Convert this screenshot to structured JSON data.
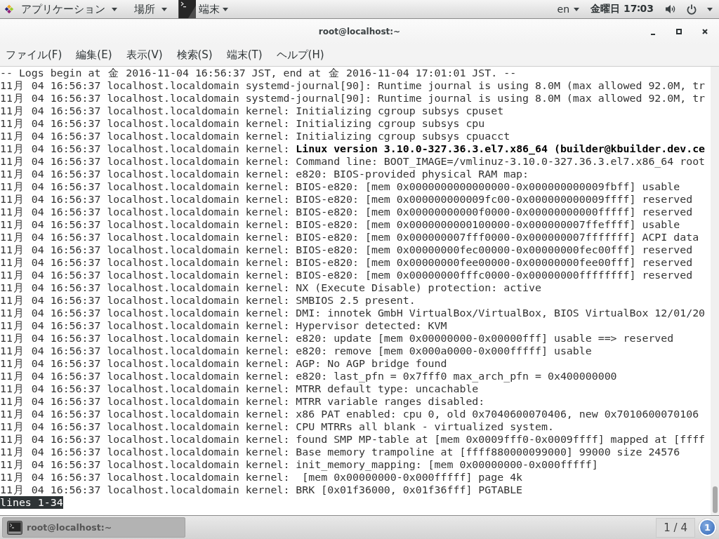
{
  "top_panel": {
    "applications": "アプリケーション",
    "places": "場所",
    "active_app": "端末",
    "input_source": "en",
    "clock": "金曜日 17∶03"
  },
  "window": {
    "title": "root@localhost:~"
  },
  "menu_bar": [
    "ファイル(F)",
    "編集(E)",
    "表示(V)",
    "検索(S)",
    "端末(T)",
    "ヘルプ(H)"
  ],
  "terminal": {
    "header": "-- Logs begin at 金 2016-11-04 16:56:37 JST, end at 金 2016-11-04 17:01:01 JST. --",
    "lines": [
      "11月 04 16:56:37 localhost.localdomain systemd-journal[90]: Runtime journal is using 8.0M (max allowed 92.0M, tr",
      "11月 04 16:56:37 localhost.localdomain systemd-journal[90]: Runtime journal is using 8.0M (max allowed 92.0M, tr",
      "11月 04 16:56:37 localhost.localdomain kernel: Initializing cgroup subsys cpuset",
      "11月 04 16:56:37 localhost.localdomain kernel: Initializing cgroup subsys cpu",
      "11月 04 16:56:37 localhost.localdomain kernel: Initializing cgroup subsys cpuacct",
      "11月 04 16:56:37 localhost.localdomain kernel: **Linux version 3.10.0-327.36.3.el7.x86_64 (builder@kbuilder.dev.ce**",
      "11月 04 16:56:37 localhost.localdomain kernel: Command line: BOOT_IMAGE=/vmlinuz-3.10.0-327.36.3.el7.x86_64 root",
      "11月 04 16:56:37 localhost.localdomain kernel: e820: BIOS-provided physical RAM map:",
      "11月 04 16:56:37 localhost.localdomain kernel: BIOS-e820: [mem 0x0000000000000000-0x000000000009fbff] usable",
      "11月 04 16:56:37 localhost.localdomain kernel: BIOS-e820: [mem 0x000000000009fc00-0x000000000009ffff] reserved",
      "11月 04 16:56:37 localhost.localdomain kernel: BIOS-e820: [mem 0x00000000000f0000-0x00000000000fffff] reserved",
      "11月 04 16:56:37 localhost.localdomain kernel: BIOS-e820: [mem 0x0000000000100000-0x000000007ffeffff] usable",
      "11月 04 16:56:37 localhost.localdomain kernel: BIOS-e820: [mem 0x000000007fff0000-0x000000007fffffff] ACPI data",
      "11月 04 16:56:37 localhost.localdomain kernel: BIOS-e820: [mem 0x00000000fec00000-0x00000000fec00fff] reserved",
      "11月 04 16:56:37 localhost.localdomain kernel: BIOS-e820: [mem 0x00000000fee00000-0x00000000fee00fff] reserved",
      "11月 04 16:56:37 localhost.localdomain kernel: BIOS-e820: [mem 0x00000000fffc0000-0x00000000ffffffff] reserved",
      "11月 04 16:56:37 localhost.localdomain kernel: NX (Execute Disable) protection: active",
      "11月 04 16:56:37 localhost.localdomain kernel: SMBIOS 2.5 present.",
      "11月 04 16:56:37 localhost.localdomain kernel: DMI: innotek GmbH VirtualBox/VirtualBox, BIOS VirtualBox 12/01/20",
      "11月 04 16:56:37 localhost.localdomain kernel: Hypervisor detected: KVM",
      "11月 04 16:56:37 localhost.localdomain kernel: e820: update [mem 0x00000000-0x00000fff] usable ==> reserved",
      "11月 04 16:56:37 localhost.localdomain kernel: e820: remove [mem 0x000a0000-0x000fffff] usable",
      "11月 04 16:56:37 localhost.localdomain kernel: AGP: No AGP bridge found",
      "11月 04 16:56:37 localhost.localdomain kernel: e820: last_pfn = 0x7fff0 max_arch_pfn = 0x400000000",
      "11月 04 16:56:37 localhost.localdomain kernel: MTRR default type: uncachable",
      "11月 04 16:56:37 localhost.localdomain kernel: MTRR variable ranges disabled:",
      "11月 04 16:56:37 localhost.localdomain kernel: x86 PAT enabled: cpu 0, old 0x7040600070406, new 0x7010600070106",
      "11月 04 16:56:37 localhost.localdomain kernel: CPU MTRRs all blank - virtualized system.",
      "11月 04 16:56:37 localhost.localdomain kernel: found SMP MP-table at [mem 0x0009fff0-0x0009ffff] mapped at [ffff",
      "11月 04 16:56:37 localhost.localdomain kernel: Base memory trampoline at [ffff880000099000] 99000 size 24576",
      "11月 04 16:56:37 localhost.localdomain kernel: init_memory_mapping: [mem 0x00000000-0x000fffff]",
      "11月 04 16:56:37 localhost.localdomain kernel:  [mem 0x00000000-0x000fffff] page 4k",
      "11月 04 16:56:37 localhost.localdomain kernel: BRK [0x01f36000, 0x01f36fff] PGTABLE"
    ],
    "pager_status": "lines 1-34"
  },
  "taskbar": {
    "tasks": [
      {
        "label": "root@localhost:~",
        "selected": true
      }
    ],
    "workspace": "1 / 4",
    "notification_count": "1"
  }
}
